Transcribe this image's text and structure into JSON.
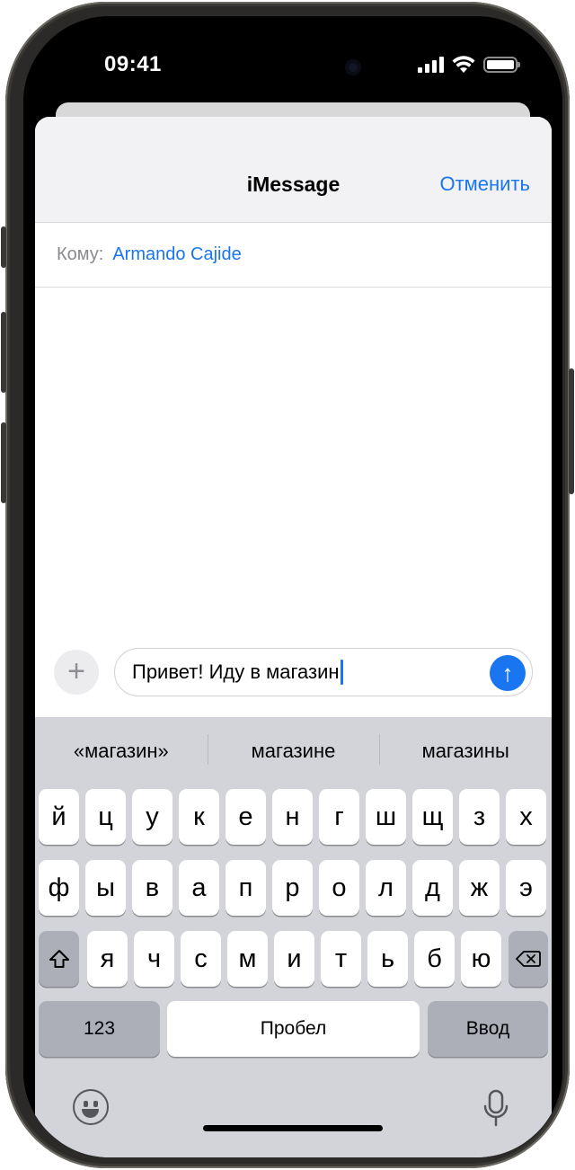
{
  "status_bar": {
    "time": "09:41"
  },
  "sheet": {
    "title": "iMessage",
    "cancel": "Отменить",
    "to_label": "Кому:",
    "to_value": "Armando Cajide"
  },
  "compose": {
    "plus": "+",
    "text": "Привет! Иду в магазин",
    "send": "↑"
  },
  "keyboard": {
    "suggestions": [
      "«магазин»",
      "магазине",
      "магазины"
    ],
    "row1": [
      "й",
      "ц",
      "у",
      "к",
      "е",
      "н",
      "г",
      "ш",
      "щ",
      "з",
      "х"
    ],
    "row2": [
      "ф",
      "ы",
      "в",
      "а",
      "п",
      "р",
      "о",
      "л",
      "д",
      "ж",
      "э"
    ],
    "row3": [
      "я",
      "ч",
      "с",
      "м",
      "и",
      "т",
      "ь",
      "б",
      "ю"
    ],
    "numbers": "123",
    "space": "Пробел",
    "return": "Ввод"
  },
  "icons": [
    "shift-icon",
    "backspace-icon",
    "emoji-icon",
    "microphone-icon",
    "signal-icon",
    "wifi-icon",
    "battery-icon"
  ],
  "colors": {
    "accent": "#1a76f0",
    "keyboard_bg": "#d2d4da",
    "function_key": "#acafb8"
  }
}
